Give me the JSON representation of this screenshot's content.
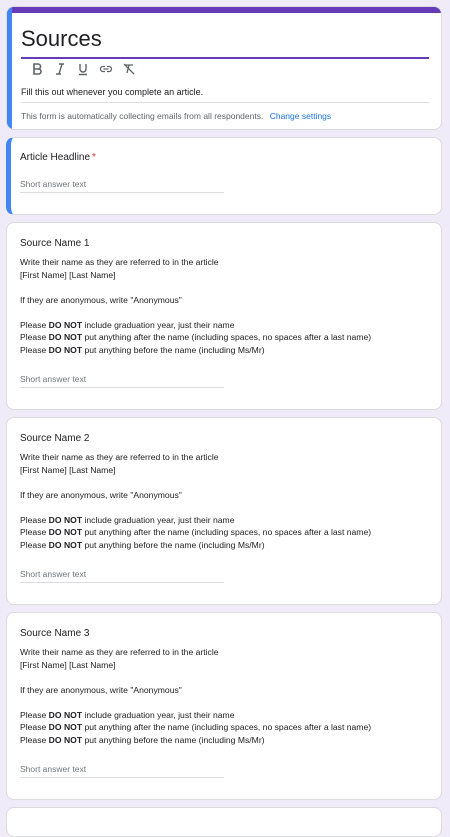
{
  "form": {
    "title": "Sources",
    "description": "Fill this out whenever you complete an article.",
    "email_note": "This form is automatically collecting emails from all respondents.",
    "change_settings": "Change settings"
  },
  "toolbar": [
    "bold-icon",
    "italic-icon",
    "underline-icon",
    "link-icon",
    "clear-format-icon"
  ],
  "q_headline": {
    "title": "Article Headline",
    "required_mark": "*",
    "placeholder": "Short answer text"
  },
  "source_help": {
    "line1": "Write their name as they are referred to in the article",
    "line2": "[First Name] [Last Name]",
    "line3": "If they are anonymous, write \"Anonymous\"",
    "please": "Please",
    "do_not": "DO NOT",
    "rule1": "include graduation year, just their name",
    "rule2": "put anything after the name (including spaces, no spaces after a last name)",
    "rule3": "put anything before the name (including Ms/Mr)"
  },
  "sources": [
    {
      "title": "Source Name 1",
      "placeholder": "Short answer text"
    },
    {
      "title": "Source Name 2",
      "placeholder": "Short answer text"
    },
    {
      "title": "Source Name 3",
      "placeholder": "Short answer text"
    }
  ]
}
